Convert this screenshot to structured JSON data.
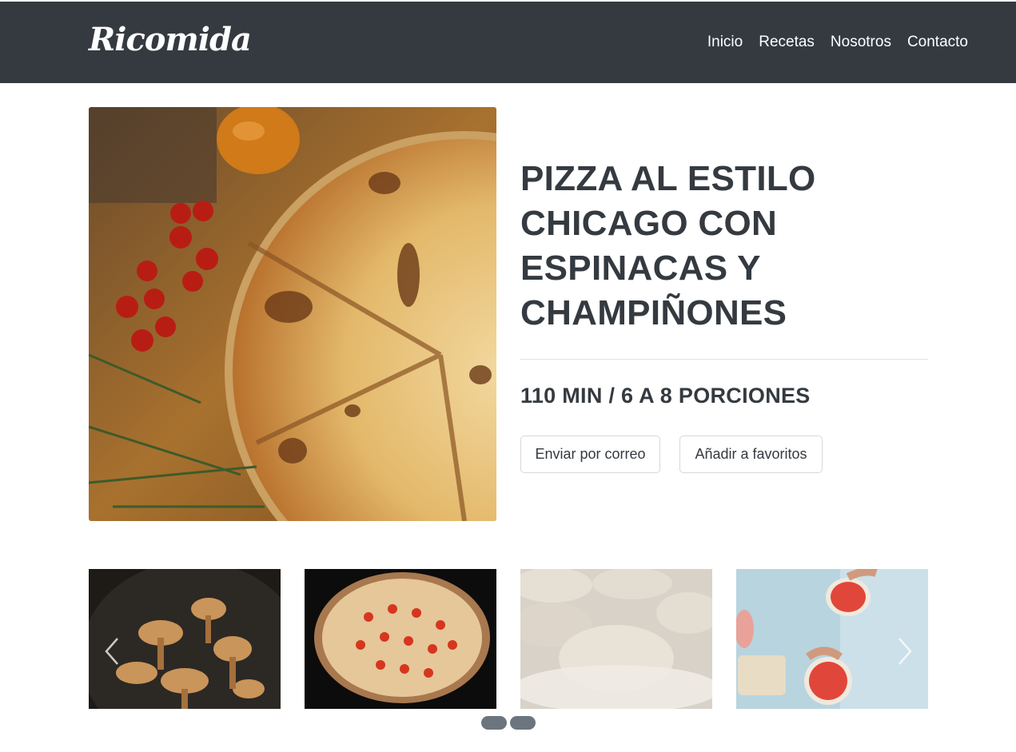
{
  "navbar": {
    "brand": "Ricomida",
    "links": [
      "Inicio",
      "Recetas",
      "Nosotros",
      "Contacto"
    ]
  },
  "recipe": {
    "title": "PIZZA AL ESTILO CHICAGO CON ESPINACAS Y CHAMPIÑONES",
    "meta": "110 MIN / 6 A 8 PORCIONES",
    "buttons": {
      "email": "Enviar por correo",
      "favorite": "Añadir a favoritos"
    }
  },
  "carousel": {
    "slides": [
      "mushrooms-photo",
      "pizza-photo",
      "dough-photo",
      "pizza-making-photo"
    ],
    "indicator_count": 2
  },
  "colors": {
    "navbar_bg": "#343a40",
    "text": "#343a40",
    "indicator": "#6c757d"
  }
}
